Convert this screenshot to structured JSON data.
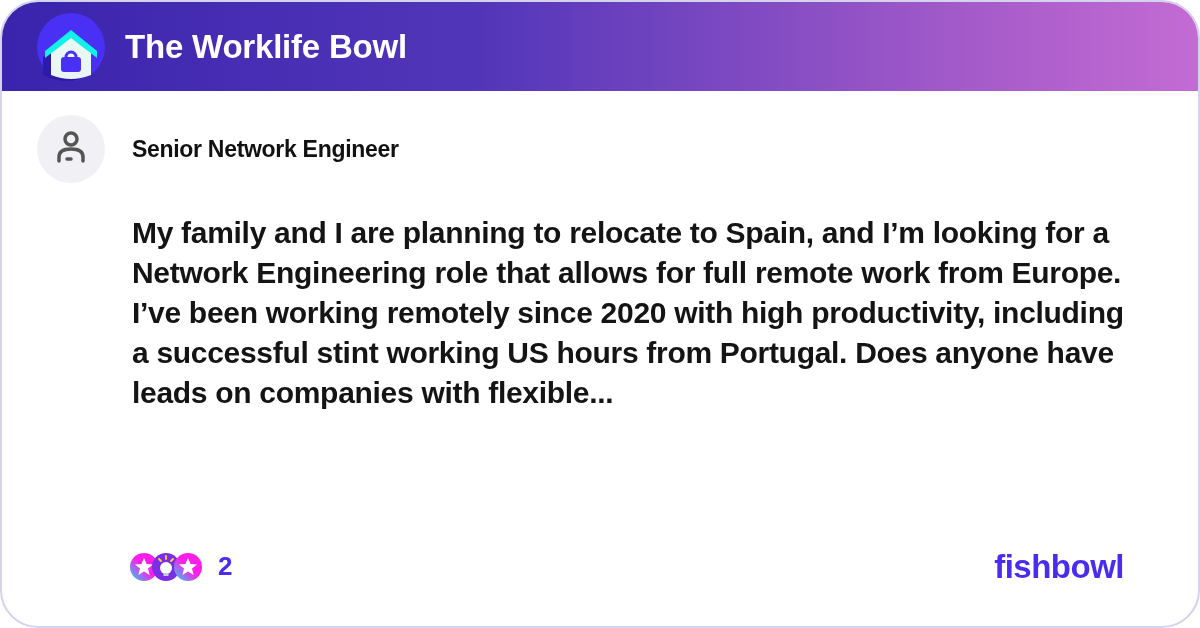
{
  "header": {
    "title": "The Worklife Bowl"
  },
  "post": {
    "author_title": "Senior Network Engineer",
    "body": "My family and I are planning to relocate to Spain, and I’m looking for a Network Engineering role that allows for full remote work from Europe. I’ve been working remotely since 2020 with high productivity, including a successful stint working US hours from Portugal. Does anyone have leads on companies with flexible..."
  },
  "footer": {
    "reaction_count": "2",
    "logo": "fishbowl"
  }
}
